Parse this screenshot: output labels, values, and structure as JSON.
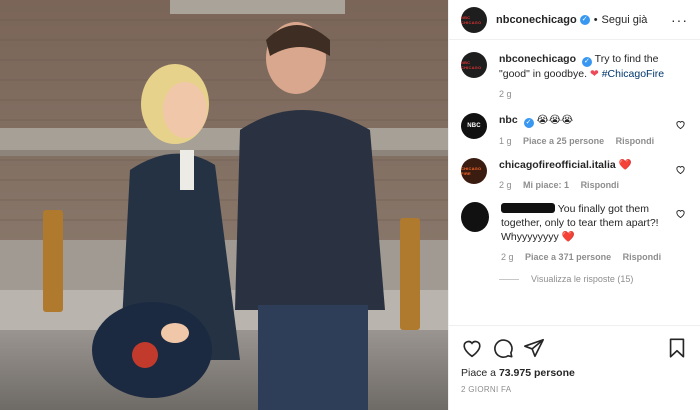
{
  "post": {
    "account": "nbconechicago",
    "follow_status": "Segui già",
    "avatar_text": "NBC CHICAGO",
    "caption": {
      "text": "Try to find the \"good\" in goodbye.",
      "hashtag": "#ChicagoFire",
      "age": "2 g"
    },
    "likes_prefix": "Piace a",
    "likes_count": "73.975",
    "likes_suffix": "persone",
    "posted_ago": "2 GIORNI FA"
  },
  "comments": [
    {
      "user": "nbc",
      "verified": true,
      "text": "😭😭😭",
      "age": "1 g",
      "likes": "Piace a 25 persone",
      "reply": "Rispondi",
      "avatar_text": "NBC"
    },
    {
      "user": "chicagofireofficial.italia",
      "verified": false,
      "text": "❤️",
      "age": "2 g",
      "likes": "Mi piace: 1",
      "reply": "Rispondi",
      "avatar_text": "CHICAGO FIRE"
    },
    {
      "user": "",
      "verified": false,
      "text": "You finally got them together, only to tear them apart?! Whyyyyyyyy",
      "heart": "❤️",
      "age": "2 g",
      "likes": "Piace a 371 persone",
      "reply": "Rispondi",
      "view_replies": "Visualizza le risposte (15)"
    }
  ],
  "colors": {
    "heart": "#ed4956",
    "verified": "#3897f0",
    "hashtag": "#00376b",
    "muted": "#8e8e8e"
  },
  "icons": [
    "heart-icon",
    "comment-icon",
    "share-icon",
    "bookmark-icon",
    "more-icon",
    "verified-icon"
  ]
}
